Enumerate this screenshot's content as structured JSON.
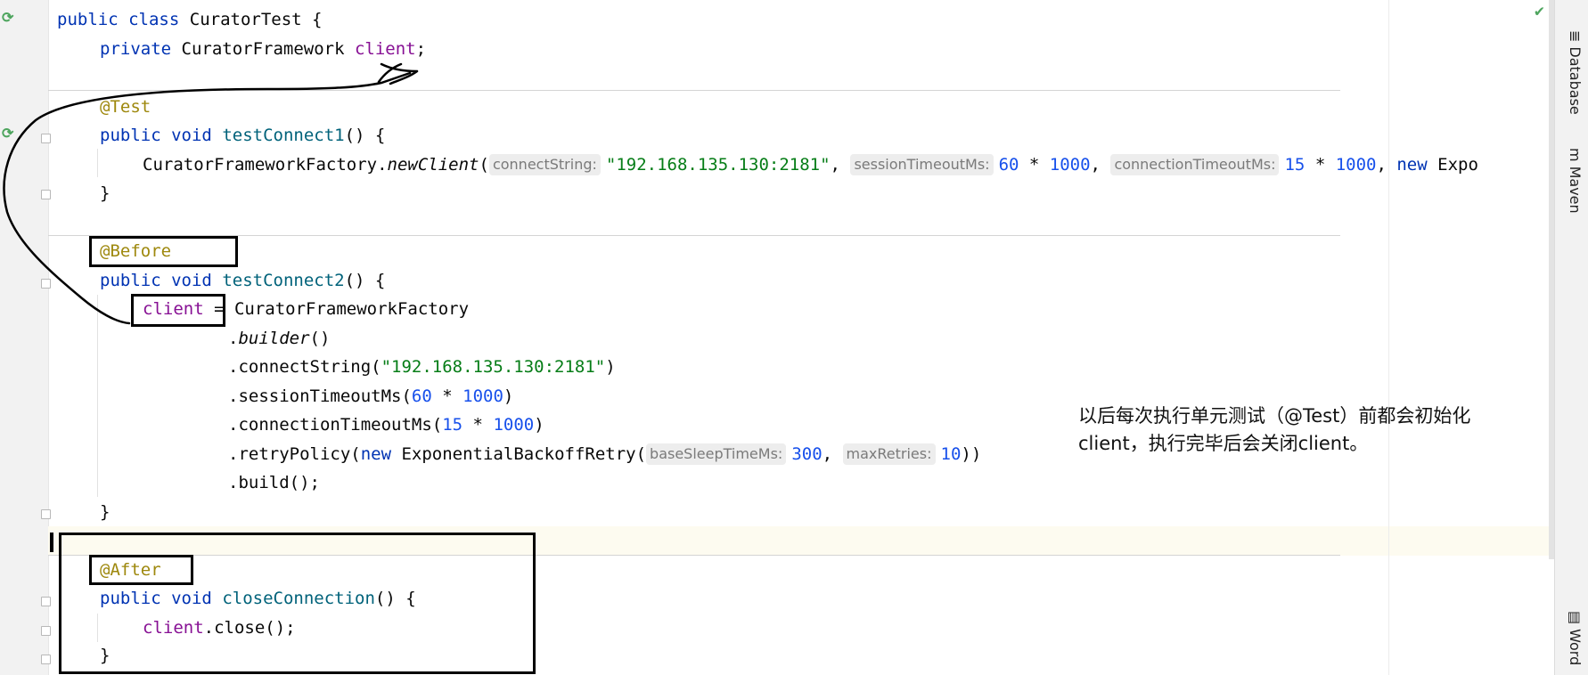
{
  "code": {
    "l1": {
      "kw1": "public",
      "kw2": "class",
      "name": "CuratorTest",
      "brace": " {"
    },
    "l2": {
      "kw": "private",
      "type": " CuratorFramework ",
      "field": "client",
      "end": ";"
    },
    "l3": {
      "ann": "@Test"
    },
    "l4": {
      "kw1": "public",
      "kw2": "void",
      "name": "testConnect1",
      "end": "() {"
    },
    "l5": {
      "obj": "CuratorFrameworkFactory.",
      "method": "newClient",
      "open": "(",
      "hint1": "connectString:",
      "str1": "\"192.168.135.130:2181\"",
      "comma1": ", ",
      "hint2": "sessionTimeoutMs:",
      "num1": "60",
      "op1": " * ",
      "num2": "1000",
      "comma2": ", ",
      "hint3": "connectionTimeoutMs:",
      "num3": "15",
      "op2": " * ",
      "num4": "1000",
      "comma3": ", ",
      "kwnew": "new",
      "tail": " Expo"
    },
    "l6": {
      "close": "}"
    },
    "l7": {
      "ann": "@Before"
    },
    "l8": {
      "kw1": "public",
      "kw2": "void",
      "name": "testConnect2",
      "end": "() {"
    },
    "l9": {
      "field": "client",
      "rest": " = CuratorFrameworkFactory"
    },
    "l10": {
      "dot": ".",
      "method": "builder",
      "end": "()"
    },
    "l11": {
      "call": ".connectString(",
      "str": "\"192.168.135.130:2181\"",
      "end": ")"
    },
    "l12": {
      "call": ".sessionTimeoutMs(",
      "num1": "60",
      "op": " * ",
      "num2": "1000",
      "end": ")"
    },
    "l13": {
      "call": ".connectionTimeoutMs(",
      "num1": "15",
      "op": " * ",
      "num2": "1000",
      "end": ")"
    },
    "l14": {
      "call": ".retryPolicy(",
      "kwnew": "new",
      "cls": " ExponentialBackoffRetry(",
      "hint1": "baseSleepTimeMs:",
      "num1": "300",
      "comma": ", ",
      "hint2": "maxRetries:",
      "num2": "10",
      "end": "))"
    },
    "l15": {
      "call": ".build();"
    },
    "l16": {
      "close": "}"
    },
    "l17": {
      "ann": "@After"
    },
    "l18": {
      "kw1": "public",
      "kw2": "void",
      "name": "closeConnection",
      "end": "() {"
    },
    "l19": {
      "field": "client",
      "rest": ".close();"
    },
    "l20": {
      "close": "}"
    }
  },
  "annotation_note": "以后每次执行单元测试（@Test）前都会初始化client，执行完毕后会关闭client。",
  "sidebar": {
    "database": "Database",
    "maven": "Maven",
    "word": "Word"
  },
  "colors": {
    "keyword": "#0033b3",
    "field": "#871094",
    "annotation": "#9e880d",
    "string": "#067d17",
    "number": "#1750eb",
    "method": "#00627a"
  },
  "icons": {
    "run": "run-test-icon",
    "fold": "fold-icon",
    "check": "check-icon",
    "database": "database-icon",
    "maven": "maven-icon",
    "word": "word-icon"
  }
}
